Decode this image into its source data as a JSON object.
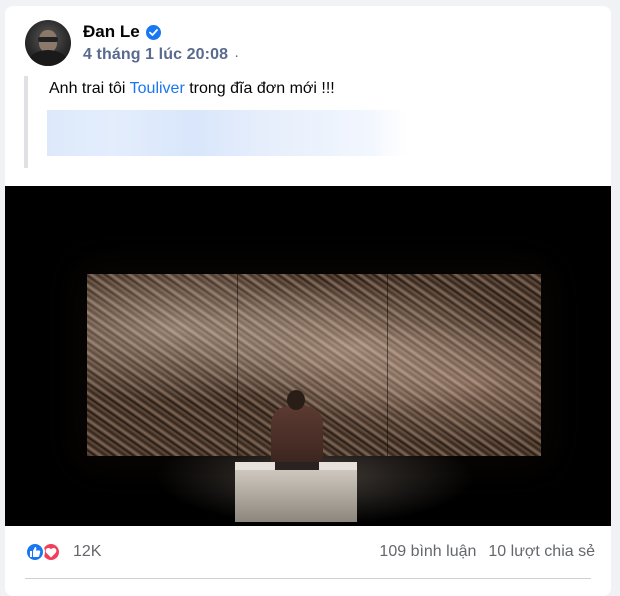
{
  "post": {
    "author": "Đan Le",
    "verified": true,
    "timestamp": "4 tháng 1 lúc 20:08",
    "separator": "·",
    "text_before": "Anh trai tôi ",
    "mention": "Touliver",
    "text_after": " trong đĩa đơn mới !!!"
  },
  "stats": {
    "reaction_icons": [
      "like-icon",
      "love-icon"
    ],
    "reaction_count": "12K",
    "comments": "109 bình luận",
    "shares": "10 lượt chia sẻ"
  },
  "colors": {
    "accent": "#1877f2",
    "love": "#f33e58",
    "secondary_text": "#65676b"
  }
}
